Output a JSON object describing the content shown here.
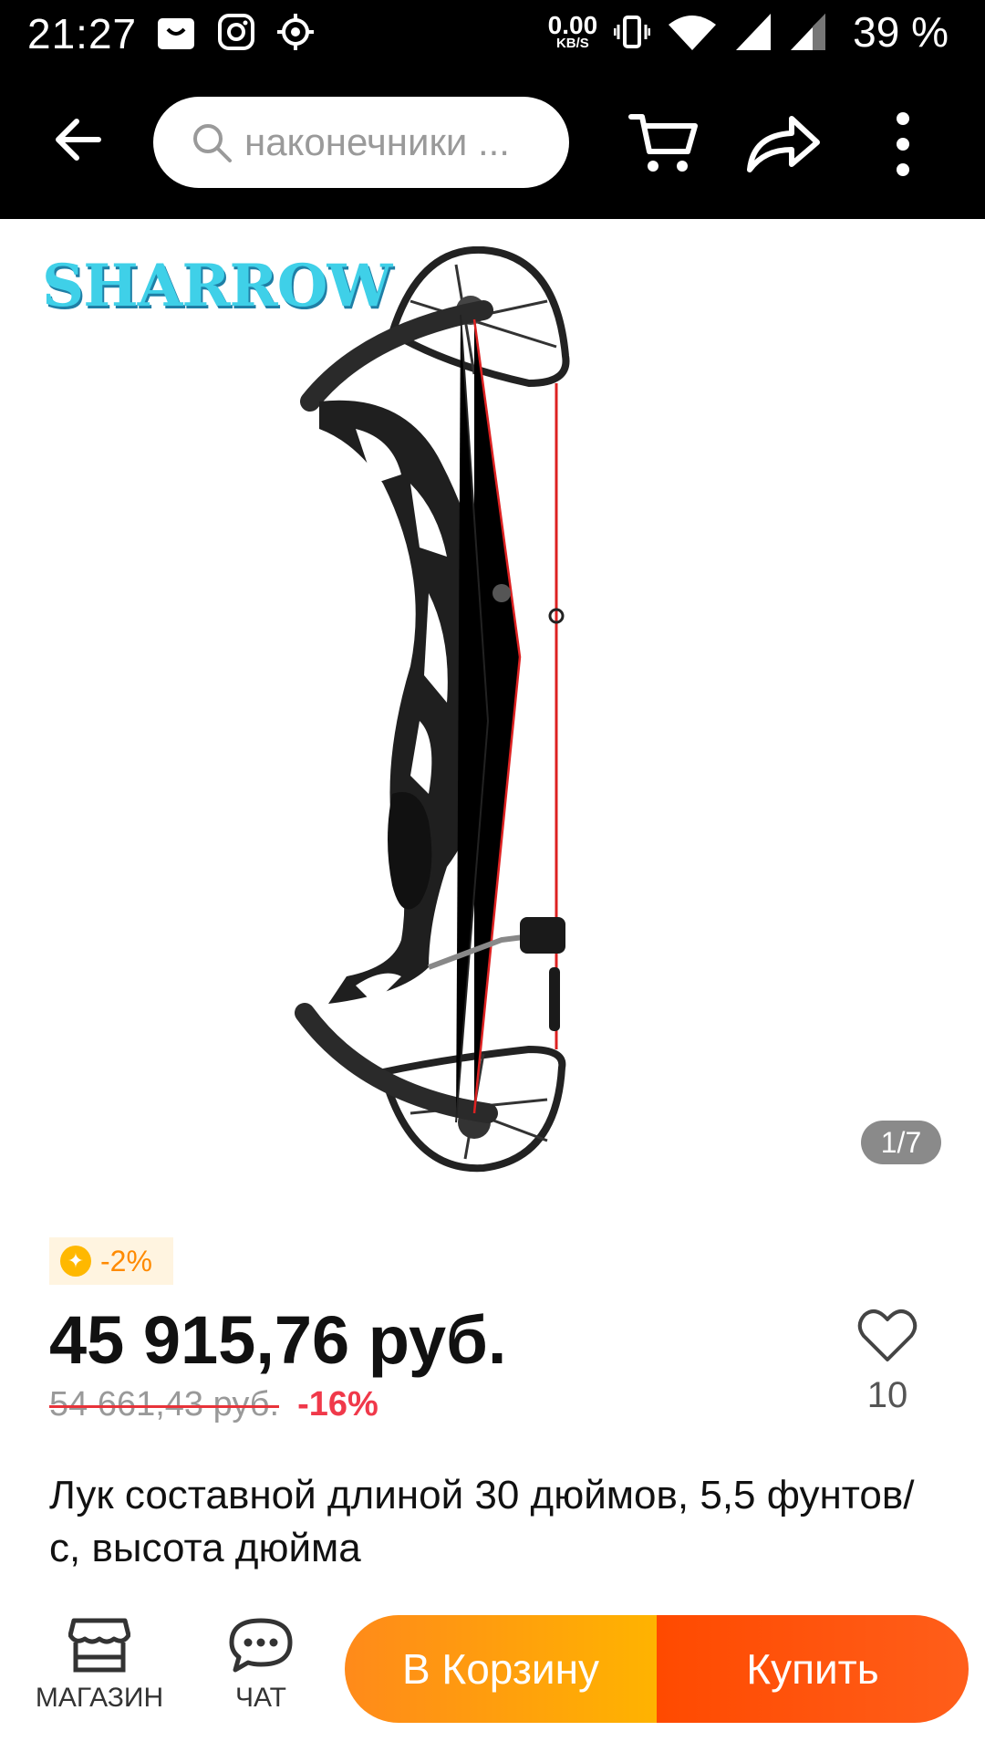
{
  "status_bar": {
    "time": "21:27",
    "net_speed_value": "0.00",
    "net_speed_unit": "KB/S",
    "battery": "39 %",
    "icons": [
      "shop-icon",
      "instagram-icon",
      "target-icon",
      "vibrate-icon",
      "wifi-icon",
      "signal-icon",
      "signal-icon"
    ]
  },
  "topbar": {
    "search_text": "наконечники ...",
    "icons": [
      "back-arrow-icon",
      "search-icon",
      "cart-icon",
      "share-icon",
      "more-vert-icon"
    ]
  },
  "gallery": {
    "brand": "SHARROW",
    "page_indicator": "1/7"
  },
  "price": {
    "coin_discount": "-2%",
    "current": "45 915,76 руб.",
    "old": "54 661,43 руб.",
    "discount": "-16%",
    "wishlist_count": "10"
  },
  "product": {
    "title": "Лук составной длиной 30 дюймов, 5,5 фунтов/с, высота дюйма"
  },
  "bottombar": {
    "store_label": "МАГАЗИН",
    "chat_label": "ЧАТ",
    "add_to_cart_label": "В Корзину",
    "buy_label": "Купить"
  },
  "colors": {
    "brand_blue": "#3fd0e8",
    "discount_red": "#f0394a",
    "cart_orange": "#ff8a1a",
    "buy_red": "#ff4a00",
    "coin_yellow": "#ffb800"
  }
}
